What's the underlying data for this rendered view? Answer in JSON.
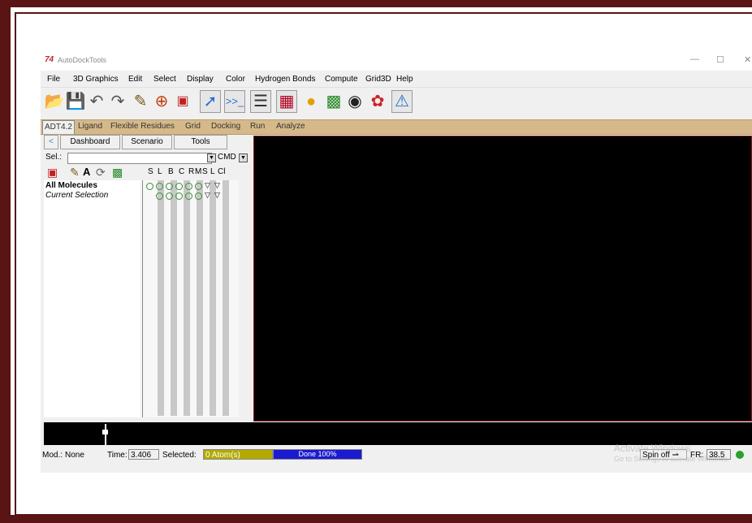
{
  "window": {
    "logo": "74",
    "title": "AutoDockTools",
    "controls": {
      "minimize": "—",
      "maximize": "☐",
      "close": "✕"
    }
  },
  "menu": [
    "File",
    "3D Graphics",
    "Edit",
    "Select",
    "Display",
    "Color",
    "Hydrogen Bonds",
    "Compute",
    "Grid3D",
    "Help"
  ],
  "toolbar_icons": [
    "open-file-icon",
    "save-icon",
    "undo-icon",
    "redo-icon",
    "pencil-icon",
    "target-icon",
    "selection-icon",
    "pointer-icon",
    "python-shell-icon",
    "text-editor-icon",
    "display-panel-icon",
    "color-spheres-icon",
    "molecule-tree-icon",
    "stereo-glasses-icon",
    "surface-icon",
    "help-icon"
  ],
  "adt_tabs": [
    "ADT4.2",
    "Ligand",
    "Flexible Residues",
    "Grid",
    "Docking",
    "Run",
    "Analyze"
  ],
  "dashboard": {
    "subtabs": [
      "Dashboard",
      "Scenario",
      "Tools"
    ],
    "back_glyph": "<",
    "sel_label": "Sel.:",
    "sel_value": "",
    "cmd_label": "CMD",
    "column_headers": [
      "S",
      "L",
      "B",
      "C",
      "R",
      "M",
      "S",
      "L",
      "Cl"
    ],
    "rows": [
      {
        "label": "All Molecules",
        "bold": true
      },
      {
        "label": "Current Selection",
        "italic": true
      }
    ]
  },
  "status": {
    "mod_label": "Mod.:",
    "mod_value": "None",
    "time_label": "Time:",
    "time_value": "3.406",
    "selected_label": "Selected:",
    "selected_value": "0 Atom(s)",
    "progress_text": "Done 100%",
    "progress": 1.0,
    "spin_label": "Spin off",
    "fr_label": "FR:",
    "fr_value": "38.5"
  },
  "watermark": {
    "line1": "Activate Windows",
    "line2": "Go to Settings to activate Windows."
  },
  "colors": {
    "frame": "#5a1414",
    "tab_strip": "#d6b98a",
    "selected_bg": "#b3a900",
    "progress_bg": "#1a1ad0",
    "viewer_bg": "#000000"
  }
}
